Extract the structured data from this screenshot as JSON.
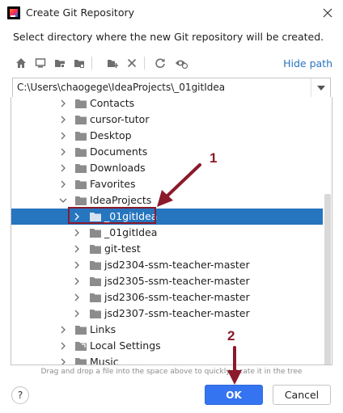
{
  "window": {
    "title": "Create Git Repository",
    "close_icon": "close-icon"
  },
  "description": "Select directory where the new Git repository will be created.",
  "toolbar": {
    "icons": [
      "home-icon",
      "desktop-icon",
      "project-folder-icon",
      "module-folder-icon",
      "new-folder-icon",
      "delete-icon",
      "refresh-icon",
      "show-hidden-icon"
    ],
    "hide_path_label": "Hide path"
  },
  "path": {
    "value": "C:\\Users\\chaogege\\IdeaProjects\\_01gitIdea"
  },
  "tree": {
    "rows": [
      {
        "label": "Contacts",
        "selected": false
      },
      {
        "label": "cursor-tutor",
        "selected": false
      },
      {
        "label": "Desktop",
        "selected": false
      },
      {
        "label": "Documents",
        "selected": false
      },
      {
        "label": "Downloads",
        "selected": false
      },
      {
        "label": "Favorites",
        "selected": false
      },
      {
        "label": "IdeaProjects",
        "selected": false
      },
      {
        "label": "_01gitIdea",
        "selected": true
      },
      {
        "label": "_01gitIdea",
        "selected": false
      },
      {
        "label": "git-test",
        "selected": false
      },
      {
        "label": "jsd2304-ssm-teacher-master",
        "selected": false
      },
      {
        "label": "jsd2305-ssm-teacher-master",
        "selected": false
      },
      {
        "label": "jsd2306-ssm-teacher-master",
        "selected": false
      },
      {
        "label": "jsd2307-ssm-teacher-master",
        "selected": false
      },
      {
        "label": "Links",
        "selected": false
      },
      {
        "label": "Local Settings",
        "selected": false
      },
      {
        "label": "Music",
        "selected": false
      }
    ]
  },
  "hint": "Drag and drop a file into the space above to quickly locate it in the tree",
  "buttons": {
    "help": "?",
    "ok": "OK",
    "cancel": "Cancel"
  },
  "annotations": {
    "step1": "1",
    "step2": "2",
    "color": "#8b1a2b"
  },
  "colors": {
    "selection": "#2675bf",
    "primary_button": "#3574f0",
    "link": "#2675bf"
  }
}
